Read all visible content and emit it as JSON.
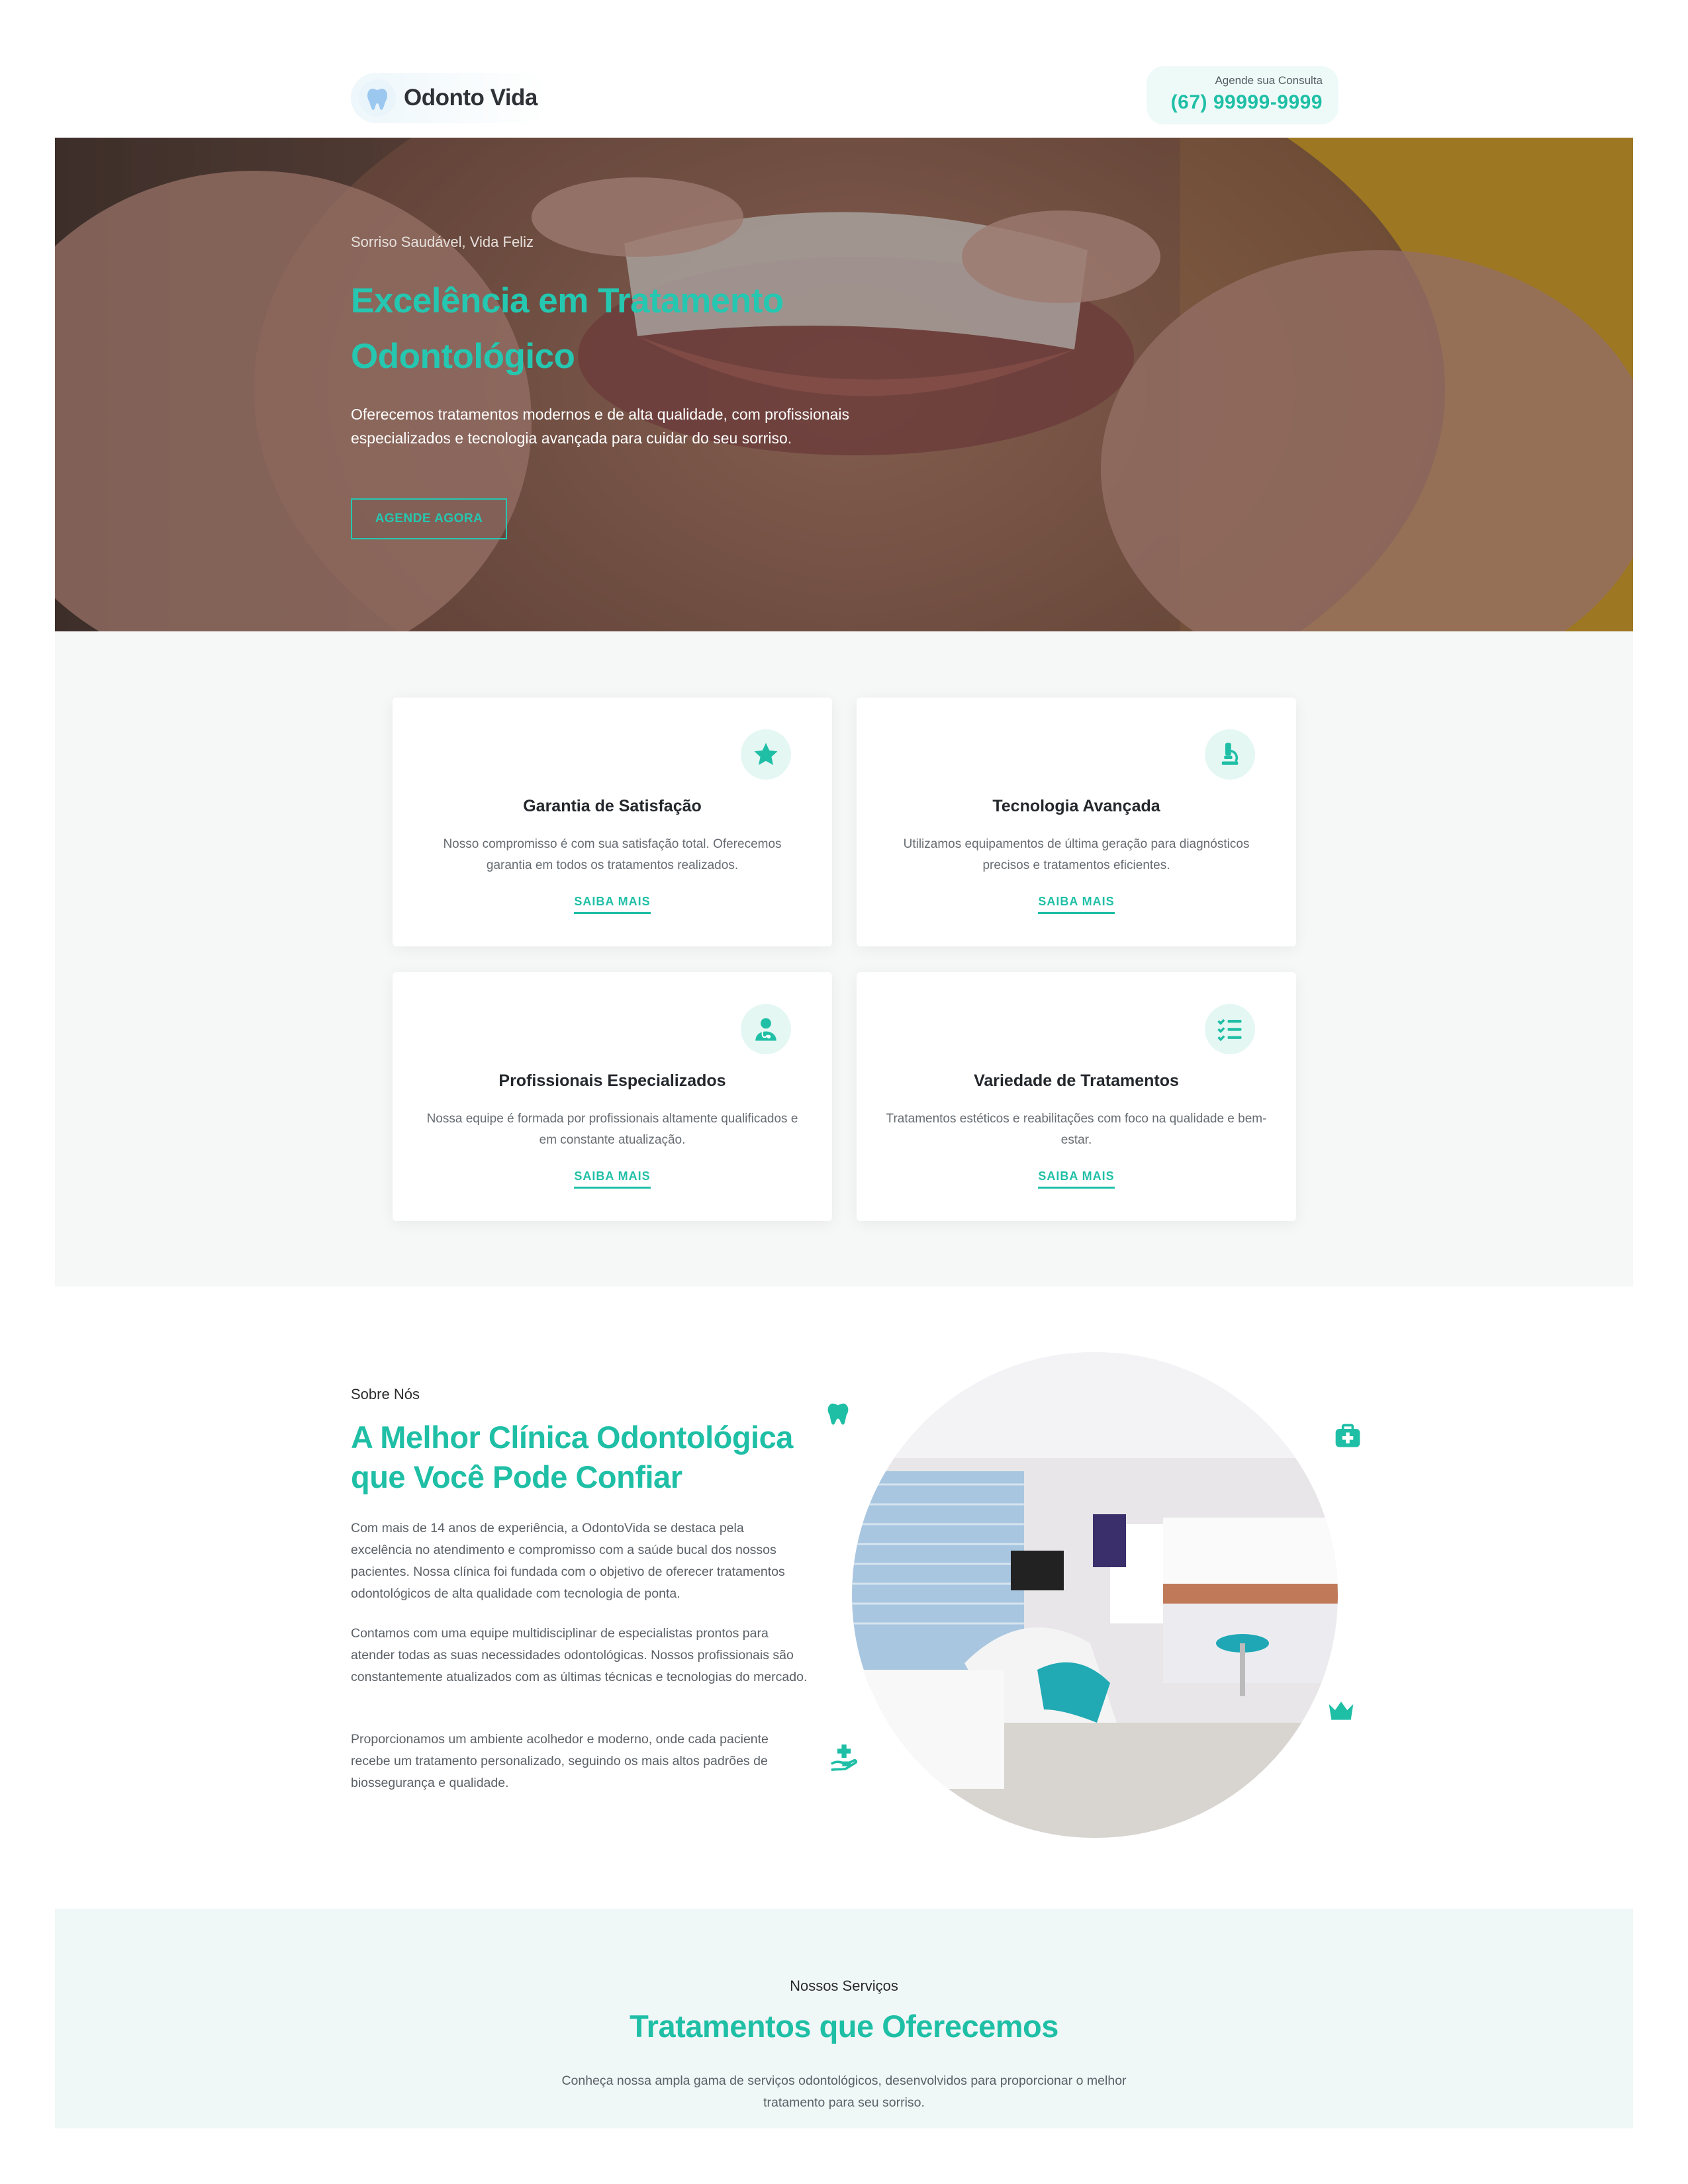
{
  "header": {
    "brand": "Odonto Vida",
    "contact_label": "Agende sua Consulta",
    "phone": "(67) 99999-9999"
  },
  "hero": {
    "eyebrow": "Sorriso Saudável, Vida Feliz",
    "title": "Excelência em Tratamento Odontológico",
    "description": "Oferecemos tratamentos modernos e de alta qualidade, com profissionais especializados e tecnologia avançada para cuidar do seu sorriso.",
    "cta_label": "AGENDE AGORA"
  },
  "features": [
    {
      "icon": "star-icon",
      "title": "Garantia de Satisfação",
      "description": "Nosso compromisso é com sua satisfação total. Oferecemos garantia em todos os tratamentos realizados.",
      "link": "SAIBA MAIS"
    },
    {
      "icon": "microscope-icon",
      "title": "Tecnologia Avançada",
      "description": "Utilizamos equipamentos de última geração para diagnósticos precisos e tratamentos eficientes.",
      "link": "SAIBA MAIS"
    },
    {
      "icon": "doctor-icon",
      "title": "Profissionais Especializados",
      "description": "Nossa equipe é formada por profissionais altamente qualificados e em constante atualização.",
      "link": "SAIBA MAIS"
    },
    {
      "icon": "checklist-icon",
      "title": "Variedade de Tratamentos",
      "description": "Tratamentos estéticos e reabilitações com foco na qualidade e bem-estar.",
      "link": "SAIBA MAIS"
    }
  ],
  "about": {
    "eyebrow": "Sobre Nós",
    "title": "A Melhor Clínica Odontológica que Você Pode Confiar",
    "paragraphs": [
      "Com mais de 14 anos de experiência, a OdontoVida se destaca pela excelência no atendimento e compromisso com a saúde bucal dos nossos pacientes. Nossa clínica foi fundada com o objetivo de oferecer tratamentos odontológicos de alta qualidade com tecnologia de ponta.",
      "Contamos com uma equipe multidisciplinar de especialistas prontos para atender todas as suas necessidades odontológicas. Nossos profissionais são constantemente atualizados com as últimas técnicas e tecnologias do mercado.",
      "Proporcionamos um ambiente acolhedor e moderno, onde cada paciente recebe um tratamento personalizado, seguindo os mais altos padrões de biossegurança e qualidade."
    ],
    "decor_icons": [
      "tooth-icon",
      "medical-kit-icon",
      "crown-icon",
      "hand-care-icon"
    ]
  },
  "services": {
    "eyebrow": "Nossos Serviços",
    "title": "Tratamentos que Oferecemos",
    "description": "Conheça nossa ampla gama de serviços odontológicos, desenvolvidos para proporcionar o melhor tratamento para seu sorriso."
  },
  "colors": {
    "accent": "#1fbfa6",
    "text_dark": "#24282d",
    "muted": "#5b6167",
    "section_bg": "#f6f7f7",
    "services_bg": "#f0f7f7"
  }
}
